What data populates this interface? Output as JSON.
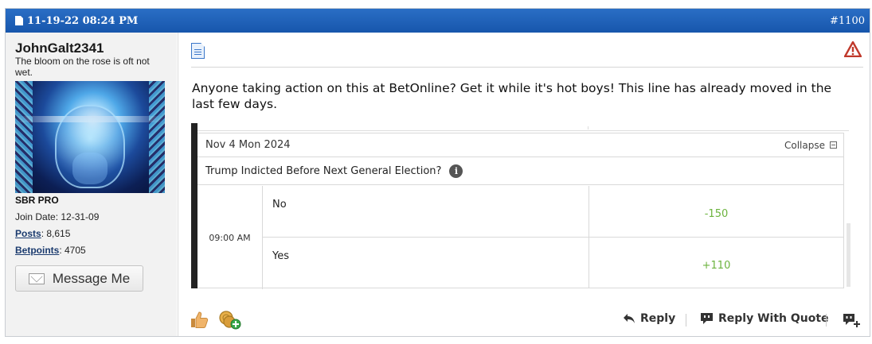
{
  "header": {
    "date": "11-19-22 08:24 PM",
    "post_number": "#1100"
  },
  "user": {
    "username": "JohnGalt2341",
    "title": "The bloom on the rose is oft not wet.",
    "rank": "SBR PRO",
    "join_date_label": "Join Date: 12-31-09",
    "posts_label": "Posts",
    "posts_value": ": 8,615",
    "betpoints_label": "Betpoints",
    "betpoints_value": ": 4705",
    "message_button": "Message Me"
  },
  "post": {
    "message": "Anyone taking action on this at BetOnline? Get it while it's hot boys! This line has already moved in the last few days.",
    "embed": {
      "date": "Nov 4 Mon 2024",
      "collapse_label": "Collapse",
      "question": "Trump Indicted Before Next General Election?",
      "time": "09:00 AM",
      "options": [
        {
          "name": "No",
          "odds": "-150"
        },
        {
          "name": "Yes",
          "odds": "+110"
        }
      ],
      "odds_color": "#6cb33e"
    }
  },
  "actions": {
    "reply": "Reply",
    "reply_with_quote": "Reply With Quote"
  },
  "colors": {
    "header_blue": "#1e5fb4",
    "warning_red": "#c0392b"
  }
}
